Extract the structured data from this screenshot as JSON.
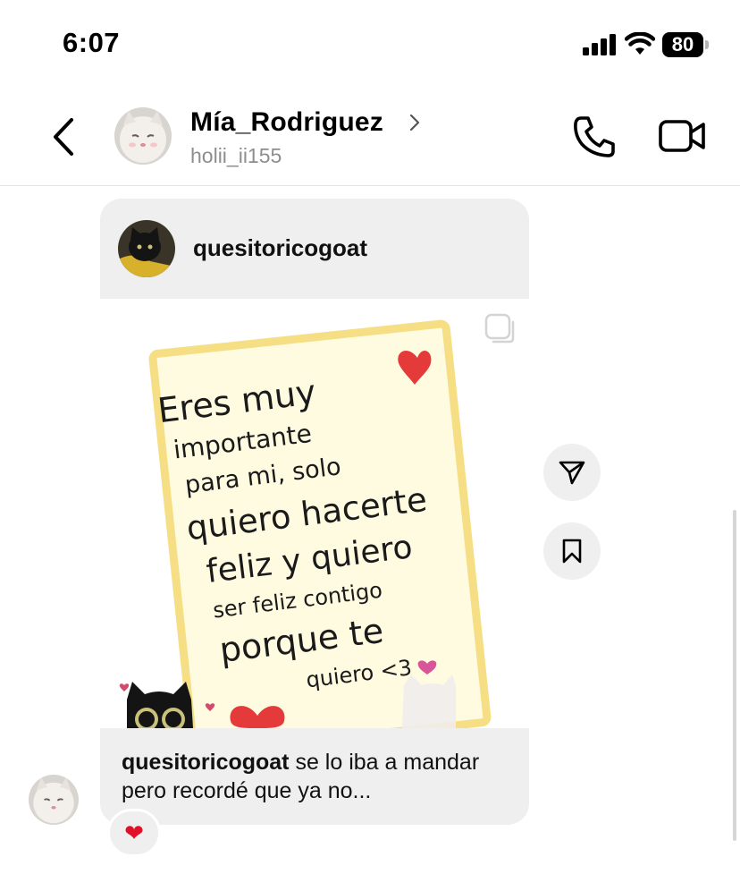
{
  "status_bar": {
    "time": "6:07",
    "battery": "80"
  },
  "header": {
    "name": "Mía_Rodriguez",
    "handle": "holii_ii155",
    "icons": [
      "back-icon",
      "chevron-right-icon",
      "phone-icon",
      "video-camera-icon"
    ]
  },
  "post": {
    "username": "quesitoricogoat",
    "image_text": [
      "Eres muy",
      "importante",
      "para mi, solo",
      "quiero hacerte",
      "feliz y quiero",
      "ser feliz contigo",
      "porque te",
      "quiero <3"
    ],
    "caption_user": "quesitoricogoat",
    "caption_text": " se lo iba a mandar pero recordé que ya no...",
    "icons": [
      "carousel-icon",
      "share-icon",
      "bookmark-icon"
    ]
  },
  "reaction": {
    "emoji": "❤"
  },
  "colors": {
    "bubble_bg": "#efefef",
    "secondary_text": "#8e8e8e",
    "paper": "#fffbe0",
    "paper_border": "#f5de83",
    "heart": "#e43a3a"
  }
}
